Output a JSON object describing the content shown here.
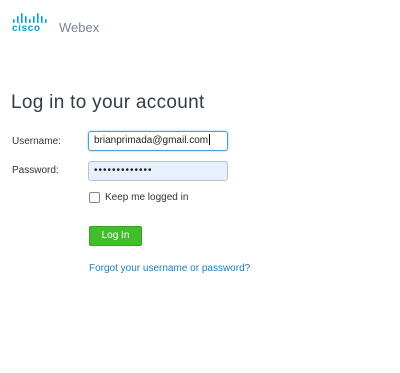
{
  "brand": {
    "company": "cisco",
    "product": "Webex",
    "logo_icon": "cisco-bridge-icon",
    "brand_color": "#049fd9",
    "product_color": "#7a8592"
  },
  "page": {
    "title": "Log in to your account"
  },
  "form": {
    "username_label": "Username:",
    "username_value": "brianprimada@gmail.com",
    "password_label": "Password:",
    "password_masked": "•••••••••••••",
    "remember_label": "Keep me logged in",
    "remember_checked": false,
    "login_label": "Log In",
    "login_color": "#3fbf2a",
    "forgot_link": "Forgot your username or password?",
    "link_color": "#1a7fbf"
  }
}
